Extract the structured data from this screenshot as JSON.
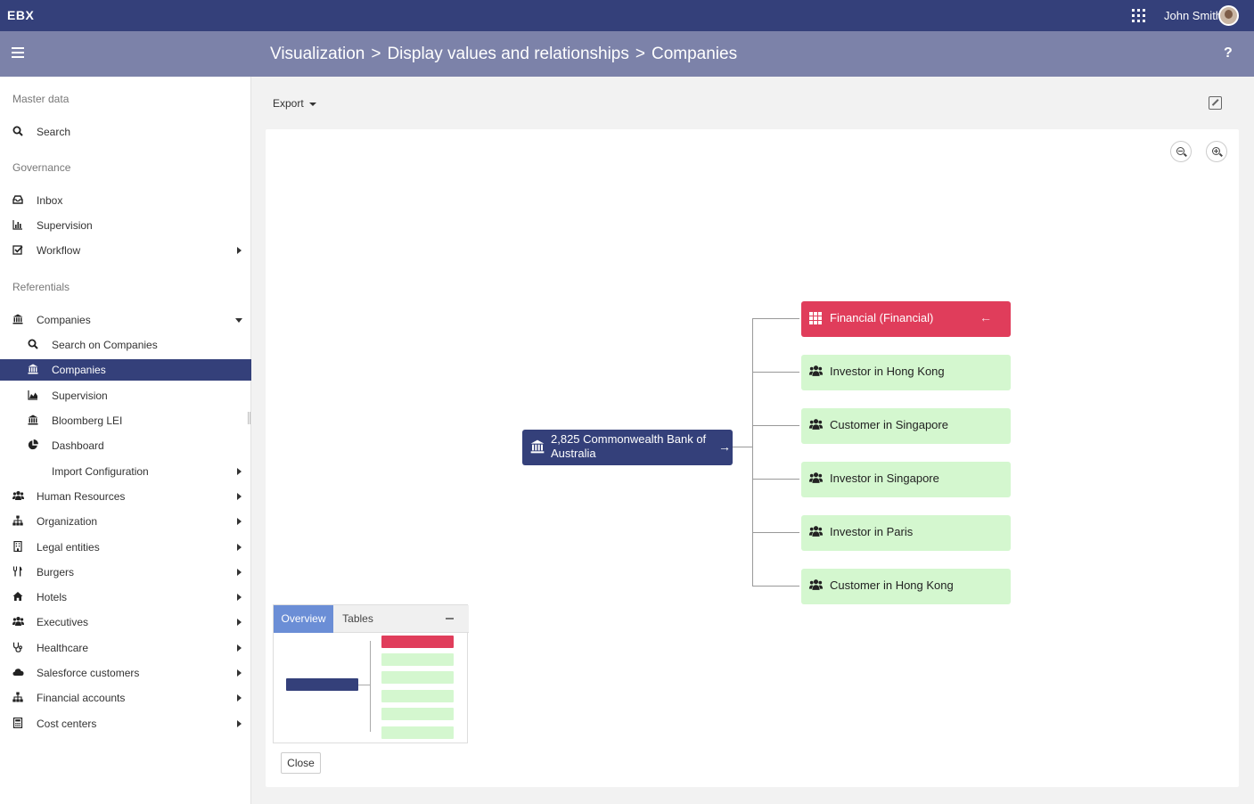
{
  "app": {
    "logo": "EBX",
    "user_name": "John Smith"
  },
  "breadcrumb": {
    "part1": "Visualization",
    "sep1": ">",
    "part2": "Display values and relationships",
    "sep2": ">",
    "part3": "Companies"
  },
  "help_label": "?",
  "sidebar": {
    "sections": {
      "master_data": "Master data",
      "governance": "Governance",
      "referentials": "Referentials"
    },
    "search": "Search",
    "inbox": "Inbox",
    "supervision": "Supervision",
    "workflow": "Workflow",
    "companies": "Companies",
    "companies_children": {
      "search_on": "Search on Companies",
      "companies": "Companies",
      "supervision": "Supervision",
      "bloomberg": "Bloomberg LEI",
      "dashboard": "Dashboard",
      "import_config": "Import Configuration"
    },
    "human_resources": "Human Resources",
    "organization": "Organization",
    "legal_entities": "Legal entities",
    "burgers": "Burgers",
    "hotels": "Hotels",
    "executives": "Executives",
    "healthcare": "Healthcare",
    "salesforce": "Salesforce customers",
    "financial_accounts": "Financial accounts",
    "cost_centers": "Cost centers"
  },
  "toolbar": {
    "export_label": "Export"
  },
  "graph": {
    "root": "2,825 Commonwealth Bank of Australia",
    "parent": "Financial (Financial)",
    "children": [
      "Investor in Hong Kong",
      "Customer in Singapore",
      "Investor in Singapore",
      "Investor in Paris",
      "Customer in Hong Kong"
    ]
  },
  "overview": {
    "tab_overview": "Overview",
    "tab_tables": "Tables",
    "close_label": "Close"
  },
  "colors": {
    "topbar": "#34407a",
    "header": "#7c82a9",
    "root_node": "#34407a",
    "parent_node": "#e03d5b",
    "child_node": "#d4f7cf",
    "overview_tab": "#6b8ed6"
  }
}
